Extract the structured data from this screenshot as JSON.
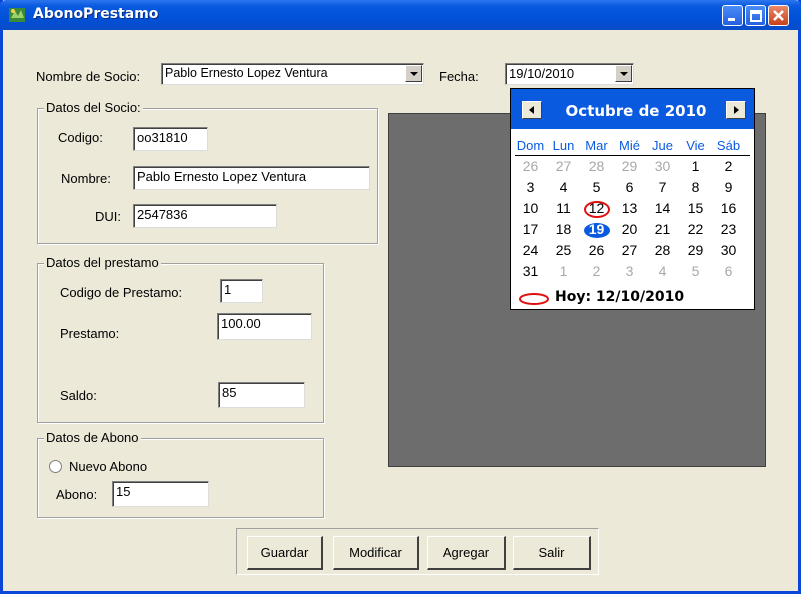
{
  "window": {
    "title": "AbonoPrestamo"
  },
  "socio": {
    "label": "Nombre de Socio:",
    "selected": "Pablo  Ernesto  Lopez Ventura"
  },
  "fecha": {
    "label": "Fecha:",
    "value": "19/10/2010"
  },
  "datos_socio": {
    "title": "Datos del Socio:",
    "codigo_label": "Codigo:",
    "codigo_value": "oo31810",
    "nombre_label": "Nombre:",
    "nombre_value": "Pablo  Ernesto  Lopez Ventura",
    "dui_label": "DUI:",
    "dui_value": "2547836"
  },
  "datos_prestamo": {
    "title": "Datos del prestamo",
    "codigo_label": "Codigo de Prestamo:",
    "codigo_value": "1",
    "prestamo_label": "Prestamo:",
    "prestamo_value": "100.00",
    "saldo_label": "Saldo:",
    "saldo_value": "85"
  },
  "datos_abono": {
    "title": "Datos de Abono",
    "radio_label": "Nuevo Abono",
    "abono_label": "Abono:",
    "abono_value": "15"
  },
  "buttons": {
    "guardar": "Guardar",
    "modificar": "Modificar",
    "agregar": "Agregar",
    "salir": "Salir"
  },
  "calendar": {
    "title": "Octubre de 2010",
    "weekdays": [
      "Dom",
      "Lun",
      "Mar",
      "Mié",
      "Jue",
      "Vie",
      "Sáb"
    ],
    "weeks": [
      [
        "26",
        "27",
        "28",
        "29",
        "30",
        "1",
        "2"
      ],
      [
        "3",
        "4",
        "5",
        "6",
        "7",
        "8",
        "9"
      ],
      [
        "10",
        "11",
        "12",
        "13",
        "14",
        "15",
        "16"
      ],
      [
        "17",
        "18",
        "19",
        "20",
        "21",
        "22",
        "23"
      ],
      [
        "24",
        "25",
        "26",
        "27",
        "28",
        "29",
        "30"
      ],
      [
        "31",
        "1",
        "2",
        "3",
        "4",
        "5",
        "6"
      ]
    ],
    "other_month": [
      [
        true,
        true,
        true,
        true,
        true,
        false,
        false
      ],
      [
        false,
        false,
        false,
        false,
        false,
        false,
        false
      ],
      [
        false,
        false,
        false,
        false,
        false,
        false,
        false
      ],
      [
        false,
        false,
        false,
        false,
        false,
        false,
        false
      ],
      [
        false,
        false,
        false,
        false,
        false,
        false,
        false
      ],
      [
        false,
        true,
        true,
        true,
        true,
        true,
        true
      ]
    ],
    "today_day": "12",
    "selected_day": "19",
    "today_text": "Hoy: 12/10/2010"
  },
  "colors": {
    "title_blue": "#0a5ae0",
    "today_ring": "#e01010",
    "panel_gray": "#6d6d6d"
  }
}
